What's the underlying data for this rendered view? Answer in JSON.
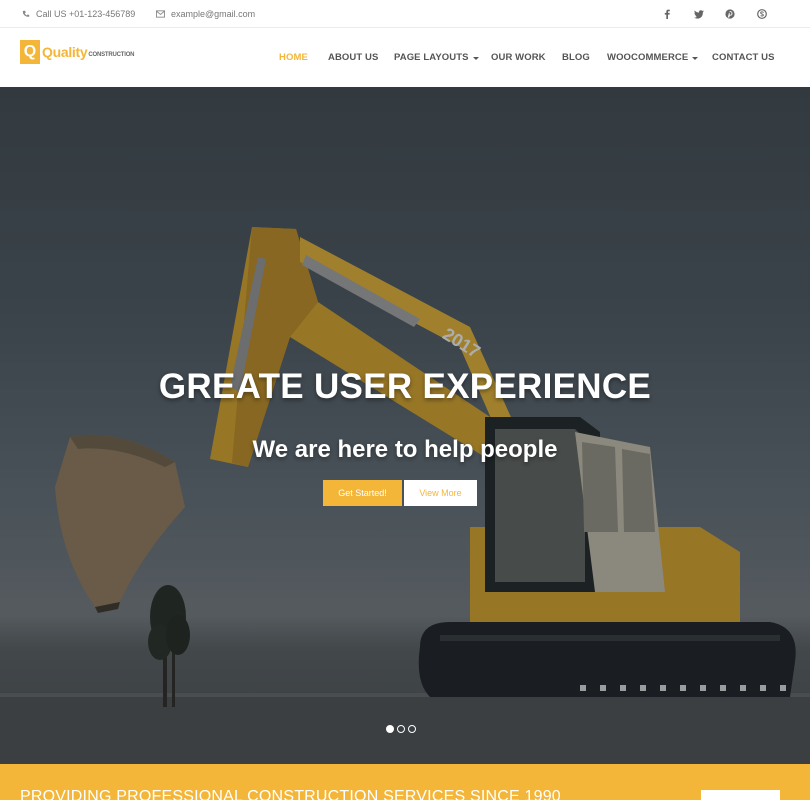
{
  "topbar": {
    "phone": "Call US +01-123-456789",
    "email": "example@gmail.com",
    "social": [
      "facebook-icon",
      "twitter-icon",
      "pinterest-icon",
      "skype-icon"
    ]
  },
  "brand": {
    "logo_letter": "Q",
    "name": "Quality",
    "tagline": "CONSTRUCTION",
    "accent": "#f4b638"
  },
  "nav": {
    "items": [
      {
        "label": "HOME",
        "active": true
      },
      {
        "label": "ABOUT US"
      },
      {
        "label": "PAGE LAYOUTS",
        "dropdown": true
      },
      {
        "label": "OUR WORK"
      },
      {
        "label": "BLOG"
      },
      {
        "label": "WOOCOMMERCE",
        "dropdown": true
      },
      {
        "label": "CONTACT US"
      }
    ]
  },
  "hero": {
    "title": "GREATE USER EXPERIENCE",
    "subtitle": "We are here to help people",
    "primary_button": "Get Started!",
    "secondary_button": "View More",
    "excavator_number": "2017",
    "slides": {
      "count": 3,
      "active": 1
    }
  },
  "cta": {
    "text": "PROVIDING PROFESSIONAL CONSTRUCTION SERVICES SINCE 1990"
  }
}
